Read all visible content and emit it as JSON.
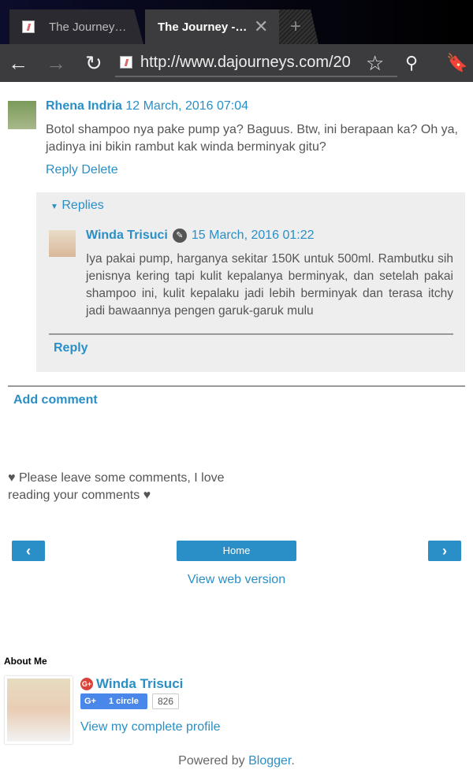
{
  "browser": {
    "tabs": [
      {
        "title": "The Journey…"
      },
      {
        "title": "The Journey -…"
      }
    ],
    "url": "http://www.dajourneys.com/20"
  },
  "comment": {
    "author": "Rhena Indria",
    "date": "12 March, 2016 07:04",
    "text": "Botol shampoo nya pake pump ya? Baguus. Btw, ini berapaan ka? Oh ya, jadinya ini bikin rambut kak winda berminyak gitu?",
    "reply": "Reply",
    "delete": "Delete",
    "replies_label": "Replies",
    "replies": [
      {
        "author": "Winda Trisuci",
        "date": "15 March, 2016 01:22",
        "text": "Iya pakai pump, harganya sekitar 150K untuk 500ml. Rambutku sih jenisnya kering tapi kulit kepalanya berminyak, dan setelah pakai shampoo ini, kulit kepalaku jadi lebih berminyak dan terasa itchy jadi bawaannya pengen garuk-garuk mulu"
      }
    ],
    "thread_reply": "Reply"
  },
  "add_comment": "Add comment",
  "note": "Please leave some comments, I love reading your comments",
  "nav": {
    "prev": "‹",
    "home": "Home",
    "next": "›",
    "web_version": "View web version"
  },
  "about": {
    "heading": "About Me",
    "name": "Winda Trisuci",
    "gplus_label": "1 circle",
    "gplus_count": "826",
    "profile_link": "View my complete profile"
  },
  "footer": {
    "powered": "Powered by ",
    "blogger": "Blogger",
    "dot": "."
  }
}
